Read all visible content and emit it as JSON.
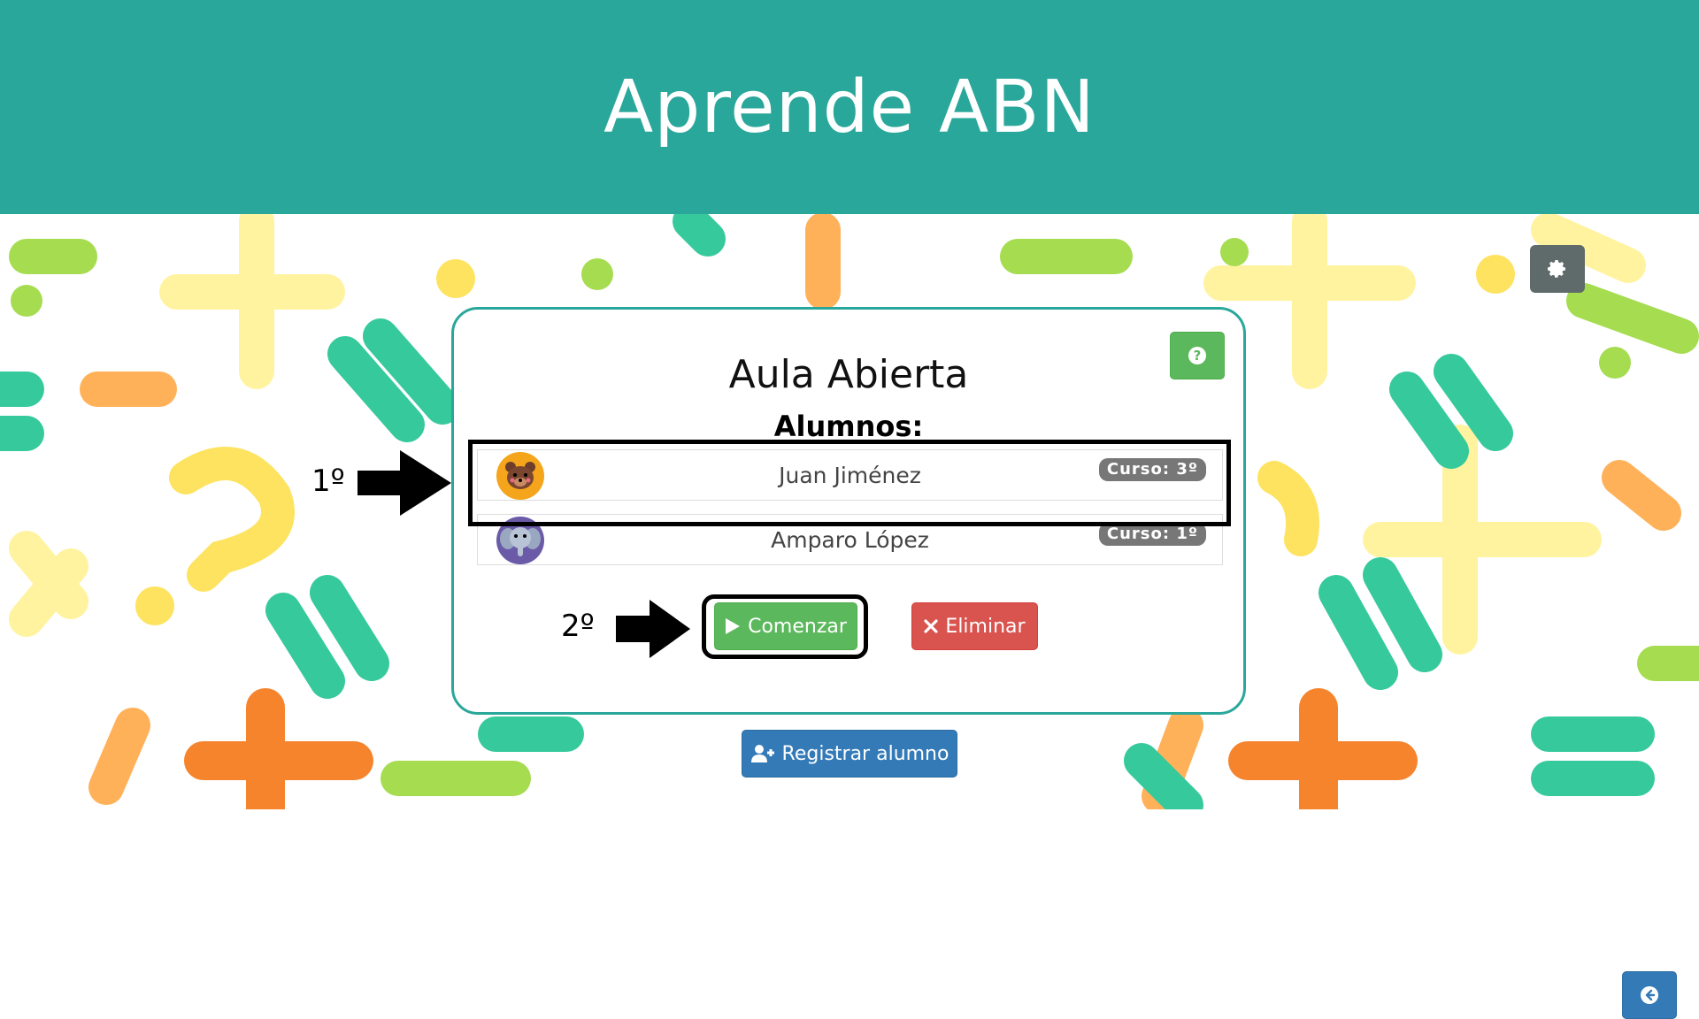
{
  "app": {
    "title": "Aprende ABN"
  },
  "settings": {
    "icon": "gear-icon"
  },
  "card": {
    "title": "Aula Abierta",
    "students_heading": "Alumnos:",
    "help_icon": "question-circle-icon",
    "students": [
      {
        "name": "Juan Jiménez",
        "grade": "Curso: 3º",
        "avatar": "bear-avatar"
      },
      {
        "name": "Amparo López",
        "grade": "Curso: 1º",
        "avatar": "elephant-avatar"
      }
    ],
    "start_label": "Comenzar",
    "delete_label": "Eliminar",
    "back_icon": "arrow-left-circle-icon"
  },
  "register_label": "Registrar alumno",
  "annotations": {
    "step1": "1º",
    "step2": "2º"
  },
  "colors": {
    "header": "#2aa79b",
    "success": "#5cb85c",
    "danger": "#d9534f",
    "primary": "#337ab7",
    "settings": "#5f6a6a"
  }
}
